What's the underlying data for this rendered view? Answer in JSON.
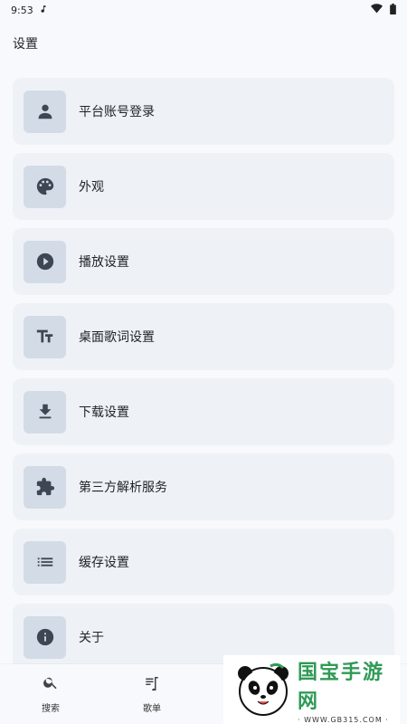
{
  "status_bar": {
    "time": "9:53",
    "icons": [
      "music-note-icon",
      "wifi-icon",
      "battery-icon"
    ]
  },
  "header": {
    "title": "设置"
  },
  "settings": [
    {
      "label": "平台账号登录",
      "icon": "person-icon"
    },
    {
      "label": "外观",
      "icon": "palette-icon"
    },
    {
      "label": "播放设置",
      "icon": "play-circle-icon"
    },
    {
      "label": "桌面歌词设置",
      "icon": "text-size-icon"
    },
    {
      "label": "下载设置",
      "icon": "download-icon"
    },
    {
      "label": "第三方解析服务",
      "icon": "puzzle-icon"
    },
    {
      "label": "缓存设置",
      "icon": "list-icon"
    },
    {
      "label": "关于",
      "icon": "info-icon"
    }
  ],
  "bottom_nav": [
    {
      "label": "搜索",
      "icon": "search-icon"
    },
    {
      "label": "歌单",
      "icon": "playlist-icon"
    }
  ],
  "watermark": {
    "title": "国宝手游网",
    "url": "· WWW.GB315.COM ·"
  },
  "colors": {
    "background": "#f7f9fc",
    "card": "#eef2f7",
    "icon_box": "#d3dbe6",
    "icon": "#3d4652",
    "watermark_green": "#2f9a55"
  }
}
